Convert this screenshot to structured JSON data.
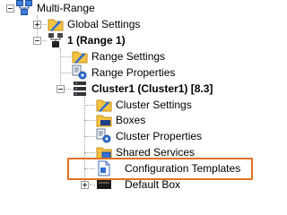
{
  "tree": {
    "root": {
      "label": "Multi-Range",
      "icon": "multi-range-network-icon"
    },
    "global_settings": {
      "label": "Global Settings",
      "icon": "folder-settings-icon"
    },
    "range": {
      "label": "1 (Range 1)",
      "icon": "range-network-icon"
    },
    "range_settings": {
      "label": "Range Settings",
      "icon": "folder-settings-icon"
    },
    "range_properties": {
      "label": "Range Properties",
      "icon": "properties-gear-icon"
    },
    "cluster": {
      "label": "Cluster1 (Cluster1) [8.3]",
      "icon": "cluster-server-icon"
    },
    "cluster_settings": {
      "label": "Cluster Settings",
      "icon": "folder-settings-icon"
    },
    "boxes": {
      "label": "Boxes",
      "icon": "boxes-folder-icon"
    },
    "cluster_properties": {
      "label": "Cluster Properties",
      "icon": "properties-gear-icon"
    },
    "shared_services": {
      "label": "Shared Services",
      "icon": "shared-services-folder-icon"
    },
    "configuration_templates": {
      "label": "Configuration Templates",
      "icon": "template-document-icon"
    },
    "default_box": {
      "label": "Default Box",
      "icon": "box-server-icon"
    }
  },
  "highlight_color": "#e3711f"
}
